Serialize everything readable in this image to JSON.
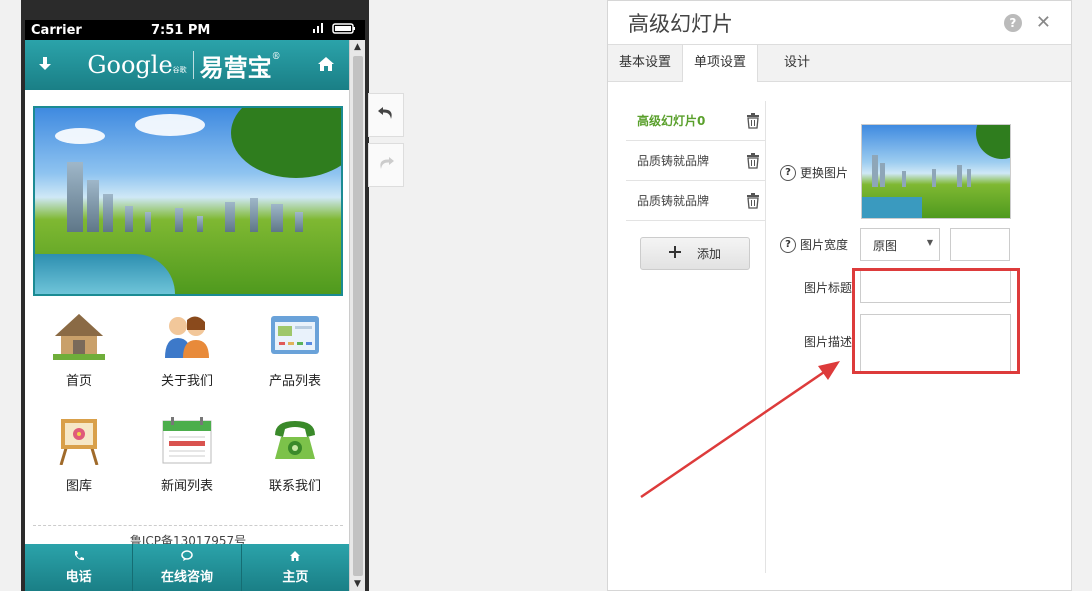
{
  "phone": {
    "status": {
      "carrier": "Carrier",
      "time": "7:51 PM"
    },
    "logo_en": "Google",
    "logo_cn": "易营宝",
    "logo_reg": "®",
    "logo_sub": "谷歌",
    "grid": [
      {
        "label": "首页",
        "icon": "home-icon"
      },
      {
        "label": "关于我们",
        "icon": "people-icon"
      },
      {
        "label": "产品列表",
        "icon": "product-list-icon"
      },
      {
        "label": "图库",
        "icon": "gallery-icon"
      },
      {
        "label": "新闻列表",
        "icon": "calendar-icon"
      },
      {
        "label": "联系我们",
        "icon": "phone-icon"
      }
    ],
    "icp": "鲁ICP备13017957号",
    "bottom_nav": [
      {
        "label": "电话",
        "icon": "phone-call-icon"
      },
      {
        "label": "在线咨询",
        "icon": "chat-icon"
      },
      {
        "label": "主页",
        "icon": "home-icon"
      }
    ]
  },
  "dialog": {
    "title": "高级幻灯片",
    "tabs": [
      "基本设置",
      "单项设置",
      "设计"
    ],
    "active_tab": "单项设置",
    "slides": [
      "高级幻灯片0",
      "品质铸就品牌",
      "品质铸就品牌"
    ],
    "add_label": "添加",
    "change_image_label": "更换图片",
    "image_width_label": "图片宽度",
    "image_width_value": "原图",
    "image_title_label": "图片标题",
    "image_desc_label": "图片描述",
    "accent_color": "#5aa02c",
    "highlight_color": "#dd3b3b"
  }
}
